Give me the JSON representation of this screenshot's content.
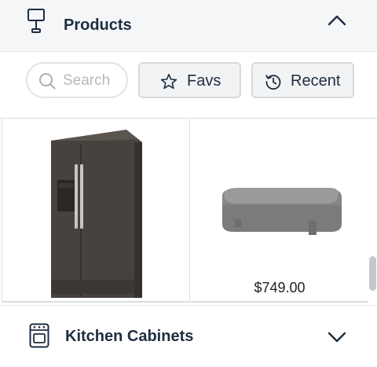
{
  "products_section": {
    "title": "Products",
    "icon": "lamp-icon",
    "toggle_icon": "chevron-up-icon"
  },
  "filters": {
    "search_placeholder": "Search",
    "favs_label": "Favs",
    "recent_label": "Recent"
  },
  "products": [
    {
      "name": "refrigerator",
      "price": ""
    },
    {
      "name": "ottoman",
      "price": "$749.00"
    }
  ],
  "kitchen_section": {
    "title": "Kitchen Cabinets",
    "icon": "oven-icon",
    "toggle_icon": "chevron-down-icon"
  },
  "colors": {
    "header_bg": "#f4f6f8",
    "text_dark": "#1e2d3f",
    "chip_bg": "#f1f3f5",
    "border": "#d6d9dd"
  }
}
